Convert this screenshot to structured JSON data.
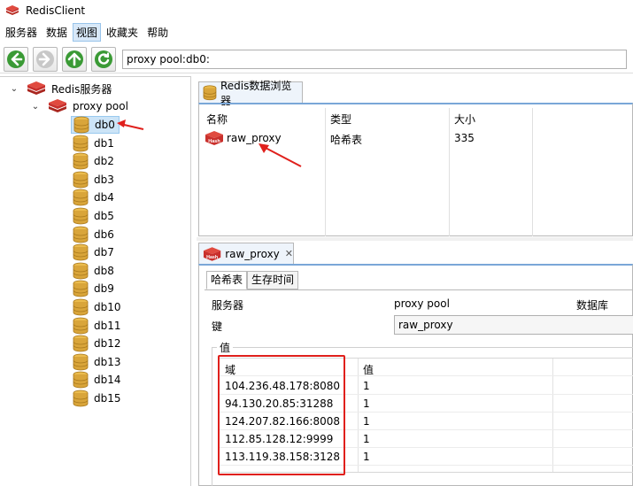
{
  "window": {
    "title": "RedisClient"
  },
  "menu": {
    "items": [
      "服务器",
      "数据",
      "视图",
      "收藏夹",
      "帮助"
    ],
    "active_index": 2
  },
  "toolbar": {
    "buttons": [
      "back-icon",
      "forward-icon",
      "up-icon",
      "refresh-icon"
    ],
    "address": "proxy pool:db0:"
  },
  "tree": {
    "root": "Redis服务器",
    "server": "proxy pool",
    "databases": [
      "db0",
      "db1",
      "db2",
      "db3",
      "db4",
      "db5",
      "db6",
      "db7",
      "db8",
      "db9",
      "db10",
      "db11",
      "db12",
      "db13",
      "db14",
      "db15"
    ],
    "selected": "db0"
  },
  "browser": {
    "tab_label": "Redis数据浏览器",
    "columns": [
      "名称",
      "类型",
      "大小"
    ],
    "rows": [
      {
        "name": "raw_proxy",
        "type": "哈希表",
        "size": "335",
        "icon_text": "Hash"
      }
    ]
  },
  "detail": {
    "tab_label": "raw_proxy",
    "subtabs": [
      "哈希表",
      "生存时间"
    ],
    "server_label": "服务器",
    "server_value": "proxy pool",
    "db_label": "数据库",
    "key_label": "键",
    "key_value": "raw_proxy",
    "value_group": "值",
    "grid_columns": [
      "域",
      "值"
    ],
    "grid_rows": [
      {
        "field": "104.236.48.178:8080",
        "value": "1"
      },
      {
        "field": "94.130.20.85:31288",
        "value": "1"
      },
      {
        "field": "124.207.82.166:8008",
        "value": "1"
      },
      {
        "field": "112.85.128.12:9999",
        "value": "1"
      },
      {
        "field": "113.119.38.158:3128",
        "value": "1"
      }
    ]
  },
  "colors": {
    "annotation": "#e0201c",
    "redis_red": "#c9302c",
    "db_gold": "#d9a53a"
  }
}
